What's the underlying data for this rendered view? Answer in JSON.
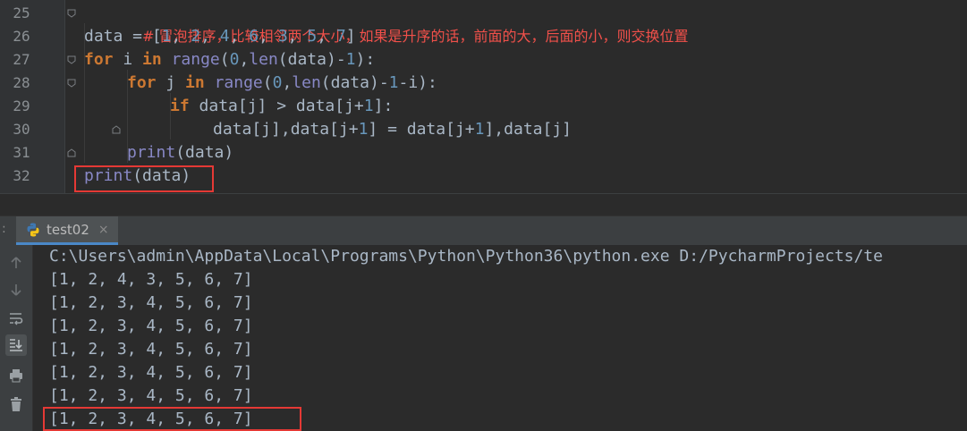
{
  "editor": {
    "line_numbers": [
      "25",
      "26",
      "27",
      "28",
      "29",
      "30",
      "31",
      "32"
    ],
    "lines": [
      {
        "comment": "# 冒泡排序，比较相邻两个大小，如果是升序的话，前面的大，后面的小，则交换位置"
      },
      {
        "parts": [
          "data = [",
          "1",
          ", ",
          "2",
          ", ",
          "4",
          ", ",
          "6",
          ", ",
          "3",
          ", ",
          "5",
          ", ",
          "7",
          "]"
        ]
      },
      {
        "parts": [
          "for",
          " i ",
          "in",
          " ",
          "range",
          "(",
          "0",
          ",",
          "len",
          "(data)-",
          "1",
          "):"
        ]
      },
      {
        "parts": [
          "for",
          " j ",
          "in",
          " ",
          "range",
          "(",
          "0",
          ",",
          "len",
          "(data)-",
          "1",
          "-i):"
        ]
      },
      {
        "parts": [
          "if",
          " data[j] > data[j+",
          "1",
          "]:"
        ]
      },
      {
        "parts": [
          "data[j],data[j+",
          "1",
          "] = data[j+",
          "1",
          "],data[j]"
        ]
      },
      {
        "parts": [
          "print",
          "(data)"
        ]
      },
      {
        "parts": [
          "print",
          "(data)"
        ]
      }
    ]
  },
  "run": {
    "tab_label": "test02",
    "close_glyph": "×",
    "colon": ":",
    "output": [
      "C:\\Users\\admin\\AppData\\Local\\Programs\\Python\\Python36\\python.exe D:/PycharmProjects/te",
      "[1, 2, 4, 3, 5, 6, 7]",
      "[1, 2, 3, 4, 5, 6, 7]",
      "[1, 2, 3, 4, 5, 6, 7]",
      "[1, 2, 3, 4, 5, 6, 7]",
      "[1, 2, 3, 4, 5, 6, 7]",
      "[1, 2, 3, 4, 5, 6, 7]",
      "[1, 2, 3, 4, 5, 6, 7]"
    ]
  },
  "toolbar": {
    "icons": [
      "arrow-up-icon",
      "arrow-down-icon",
      "soft-wrap-icon",
      "scroll-to-end-icon",
      "print-icon",
      "trash-icon"
    ]
  },
  "colors": {
    "highlight_box": "#e53935",
    "comment_zh": "#f0504a",
    "keyword": "#cc7832",
    "builtin": "#8888c6",
    "number": "#6897bb"
  }
}
